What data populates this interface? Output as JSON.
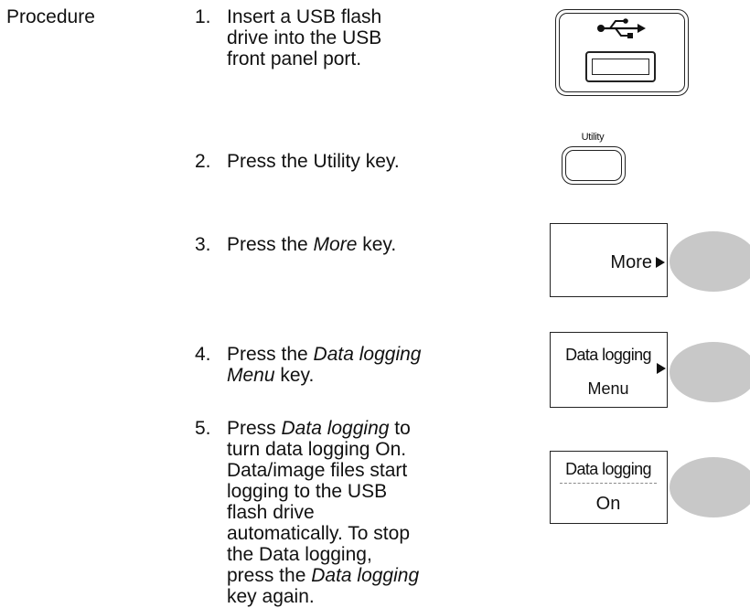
{
  "section_label": "Procedure",
  "steps": [
    {
      "num": "1.",
      "text": "Insert a USB flash drive into the USB front panel port."
    },
    {
      "num": "2.",
      "text": "Press the Utility key."
    },
    {
      "num": "3.",
      "pre": "Press the ",
      "em": "More",
      "post": " key."
    },
    {
      "num": "4.",
      "pre": "Press the ",
      "em": "Data logging Menu",
      "post": " key."
    },
    {
      "num": "5.",
      "pre": "Press ",
      "em": "Data logging",
      "post": " to turn data logging On. Data/image files start logging to the USB flash drive automatically. To stop the Data logging, press the ",
      "em2": "Data logging",
      "post2": " key again."
    }
  ],
  "keys": {
    "utility_label": "Utility",
    "more_label": "More",
    "dl_menu_line1": "Data logging",
    "dl_menu_line2": "Menu",
    "dl_on_line1": "Data logging",
    "dl_on_line2": "On"
  },
  "icons": {
    "usb": "usb-trident-icon"
  },
  "colors": {
    "soft_button": "#c8c8c8",
    "outline": "#222222"
  }
}
